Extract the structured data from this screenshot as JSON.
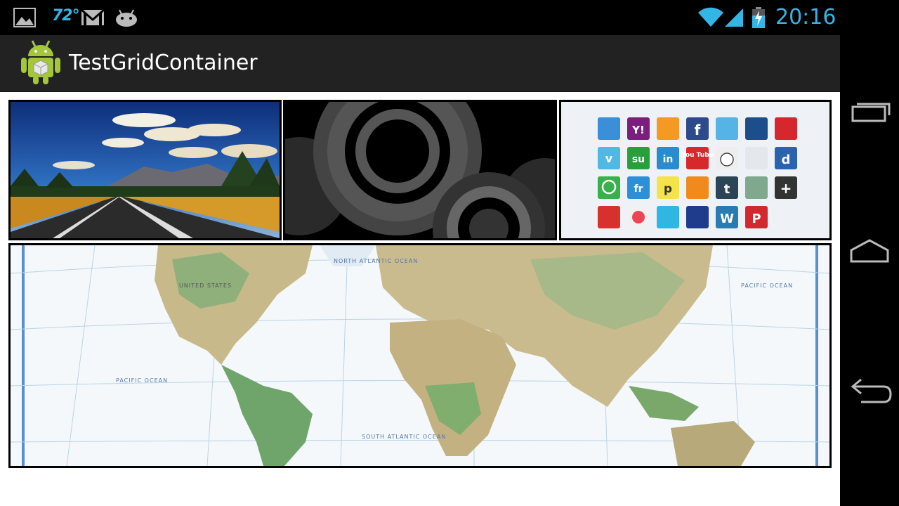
{
  "status_bar": {
    "temperature": "72°",
    "time": "20:16",
    "icons": [
      "image-notification-icon",
      "weather-icon",
      "gmail-icon",
      "android-notification-icon",
      "wifi-icon",
      "signal-icon",
      "battery-charging-icon"
    ]
  },
  "action_bar": {
    "title": "TestGridContainer",
    "icon": "android-app-icon"
  },
  "grid": {
    "tiles": [
      {
        "name": "road-landscape-image"
      },
      {
        "name": "gears-image"
      },
      {
        "name": "social-icons-image"
      },
      {
        "name": "world-map-image"
      }
    ],
    "map_labels": {
      "north_atlantic": "NORTH ATLANTIC OCEAN",
      "pacific_left": "PACIFIC OCEAN",
      "pacific_right": "PACIFIC OCEAN",
      "south_atlantic": "SOUTH ATLANTIC OCEAN",
      "united_states": "UNITED STATES"
    },
    "social_labels": {
      "youtube": "You Tube",
      "facebook": "f",
      "tumblr": "t",
      "delicious": "d",
      "stumble": "su",
      "linkedin": "in",
      "pinterest": "P",
      "wordpress": "W",
      "plus": "+",
      "yahoo": "Y!",
      "vimeo": "v",
      "friendfeed": "fr",
      "posterous": "p"
    }
  },
  "nav_bar": {
    "buttons": [
      "recent-apps",
      "home",
      "back"
    ]
  },
  "colors": {
    "accent": "#33b5e5",
    "action_bar": "#222222",
    "status_bar": "#000000"
  }
}
